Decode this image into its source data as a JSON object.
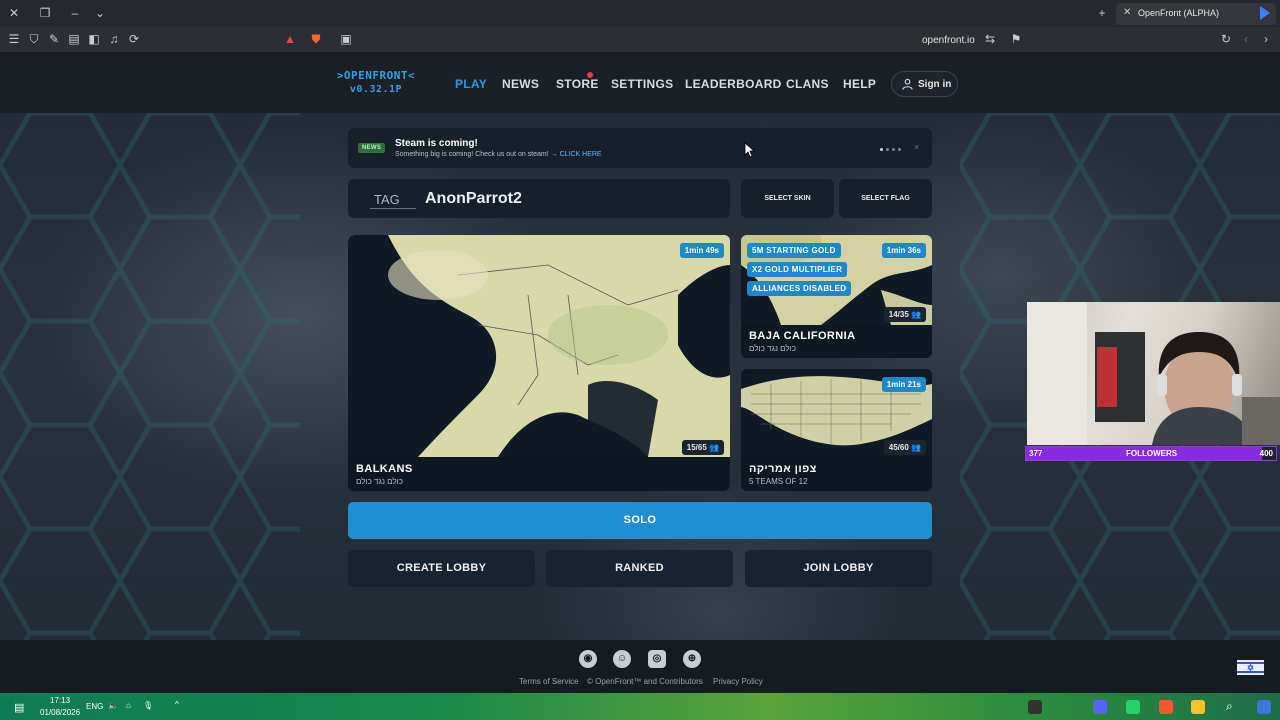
{
  "browser": {
    "tab_title": "OpenFront (ALPHA)",
    "url": "openfront.io"
  },
  "nav": {
    "logo_line1": ">OPENFRONT<",
    "logo_line2": "v0.32.1P",
    "items": [
      "PLAY",
      "NEWS",
      "STORE",
      "SETTINGS",
      "LEADERBOARD",
      "CLANS",
      "HELP"
    ],
    "active": "PLAY",
    "sign_in": "Sign in"
  },
  "news": {
    "badge": "NEWS",
    "title": "Steam is coming!",
    "body": "Something big is coming! Check us out on steam! →",
    "link": "CLICK HERE",
    "close": "×"
  },
  "player": {
    "tag_placeholder": "TAG",
    "username": "AnonParrot2",
    "select_skin": "SELECT SKIN",
    "select_flag": "SELECT FLAG"
  },
  "lobbies": [
    {
      "map": "BALKANS",
      "mode": "כולם נגד כולם",
      "timer": "1min 49s",
      "players": "15/65",
      "modifiers": []
    },
    {
      "map": "BAJA CALIFORNIA",
      "mode": "כולם נגד כולם",
      "timer": "1min 36s",
      "players": "14/35",
      "modifiers": [
        "5M STARTING GOLD",
        "X2 GOLD MULTIPLIER",
        "ALLIANCES DISABLED"
      ]
    },
    {
      "map": "צפון אמריקה",
      "mode": "5 TEAMS OF 12",
      "timer": "1min 21s",
      "players": "45/60",
      "modifiers": []
    }
  ],
  "actions": {
    "solo": "SOLO",
    "create_lobby": "CREATE LOBBY",
    "ranked": "RANKED",
    "join_lobby": "JOIN LOBBY"
  },
  "footer": {
    "terms": "Terms of Service",
    "copyright": "© OpenFront™ and Contributors",
    "privacy": "Privacy Policy",
    "icons": [
      "github-icon",
      "reddit-icon",
      "discord-icon",
      "globe-icon"
    ]
  },
  "overlay": {
    "followers_current": "377",
    "followers_label": "FOLLOWERS",
    "followers_goal": "400",
    "followers_progress": 0.9425
  },
  "taskbar": {
    "time": "17:13",
    "date": "01/08/2026",
    "lang": "ENG"
  },
  "colors": {
    "accent": "#1e8fd1",
    "active_nav": "#2a9ad6",
    "panel": "#15202b",
    "followers_bar": "#8a2be2"
  }
}
